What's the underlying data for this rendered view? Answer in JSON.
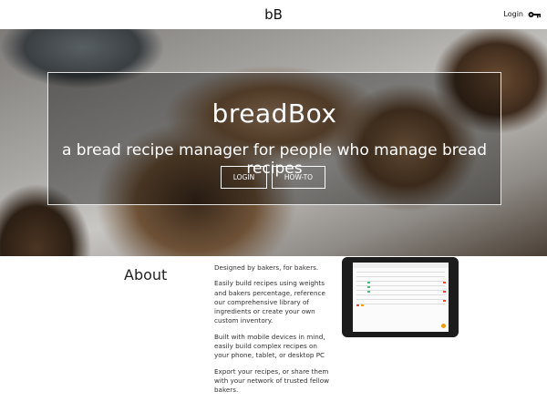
{
  "nav": {
    "brand": "bB",
    "login_label": "Login",
    "login_icon": "key-icon"
  },
  "hero": {
    "title": "breadBox",
    "subtitle": "a bread recipe manager for people who manage bread recipes",
    "buttons": {
      "login": "LOGIN",
      "howto": "HOW-TO"
    }
  },
  "about": {
    "title": "About",
    "paragraphs": [
      "Designed by bakers, for bakers.",
      "Easily build recipes using weights and bakers percentage, reference our comprehensive library of ingredients or create your own custom inventory.",
      "Built with mobile devices in mind, easily build complex recipes on your phone, tablet, or desktop PC",
      "Export your recipes, or share them with your network of trusted fellow bakers."
    ]
  },
  "colors": {
    "accent_orange": "#f39c12",
    "accent_green": "#2ecc71",
    "accent_red": "#e74c3c"
  }
}
